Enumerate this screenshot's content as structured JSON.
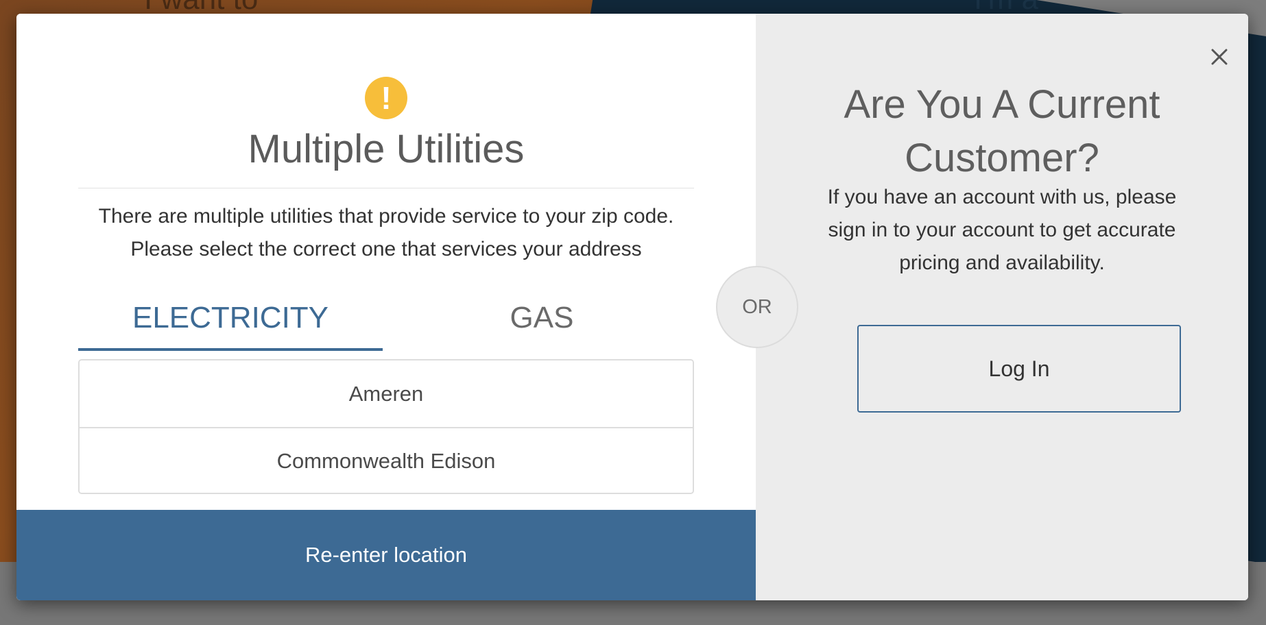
{
  "background": {
    "left_text": "I want to",
    "right_text": "I'm a"
  },
  "modal": {
    "left": {
      "icon": "warning-exclamation-icon",
      "icon_glyph": "!",
      "title": "Multiple Utilities",
      "description_line1": "There are multiple utilities that provide service to your zip code.",
      "description_line2": "Please select the correct one that services your address",
      "tabs": [
        {
          "label": "ELECTRICITY",
          "active": true
        },
        {
          "label": "GAS",
          "active": false
        }
      ],
      "utilities": [
        "Ameren",
        "Commonwealth Edison"
      ],
      "reenter_label": "Re-enter location"
    },
    "or_label": "OR",
    "right": {
      "close_icon": "close-icon",
      "title_line1": "Are You A Current",
      "title_line2": "Customer?",
      "description_line1": "If you have an account with us, please",
      "description_line2": "sign in to your account to get accurate",
      "description_line3": "pricing and availability.",
      "login_label": "Log In"
    }
  },
  "colors": {
    "accent": "#3d6a94",
    "warning": "#f7be3a",
    "right_panel_bg": "#ececec"
  }
}
